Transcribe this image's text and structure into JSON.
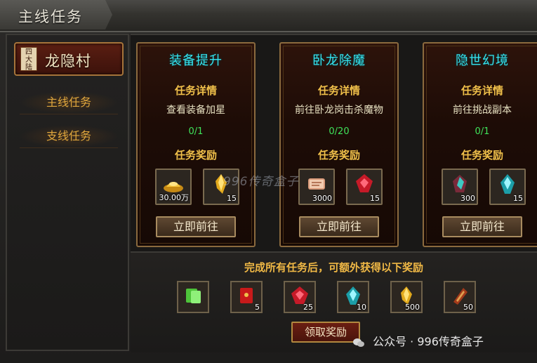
{
  "window": {
    "title": "主线任务"
  },
  "sidebar": {
    "region": {
      "stamp": "四大陆",
      "name": "龙隐村"
    },
    "items": [
      {
        "label": "主线任务"
      },
      {
        "label": "支线任务"
      }
    ]
  },
  "quests": [
    {
      "title": "装备提升",
      "detail_label": "任务详情",
      "description": "查看装备加星",
      "progress": "0/1",
      "reward_label": "任务奖励",
      "rewards": [
        {
          "icon": "gold-ingot-icon",
          "qty": "30.00万"
        },
        {
          "icon": "golden-crystal-icon",
          "qty": "15"
        }
      ],
      "button": "立即前往"
    },
    {
      "title": "卧龙除魔",
      "detail_label": "任务详情",
      "description": "前往卧龙岗击杀魔物",
      "progress": "0/20",
      "reward_label": "任务奖励",
      "rewards": [
        {
          "icon": "scroll-icon",
          "qty": "3000"
        },
        {
          "icon": "red-gem-icon",
          "qty": "15"
        }
      ],
      "button": "立即前往"
    },
    {
      "title": "隐世幻境",
      "detail_label": "任务详情",
      "description": "前往挑战副本",
      "progress": "0/1",
      "reward_label": "任务奖励",
      "rewards": [
        {
          "icon": "red-crystal-icon",
          "qty": "300"
        },
        {
          "icon": "cyan-crystal-icon",
          "qty": "15"
        }
      ],
      "button": "立即前往"
    }
  ],
  "bonus": {
    "text": "完成所有任务后，可额外获得以下奖励",
    "items": [
      {
        "icon": "green-scroll-icon",
        "qty": ""
      },
      {
        "icon": "red-envelope-icon",
        "qty": "5"
      },
      {
        "icon": "red-gem-icon",
        "qty": "25"
      },
      {
        "icon": "cyan-crystal-icon",
        "qty": "10"
      },
      {
        "icon": "golden-crystal-icon",
        "qty": "500"
      },
      {
        "icon": "armor-icon",
        "qty": "50"
      }
    ],
    "button": "领取奖励"
  },
  "watermark": {
    "center": "996传奇盒子",
    "footer": "公众号 · 996传奇盒子"
  },
  "colors": {
    "title_cyan": "#35e3ee",
    "label_gold": "#f0c04a",
    "progress_green": "#3fe35a"
  }
}
